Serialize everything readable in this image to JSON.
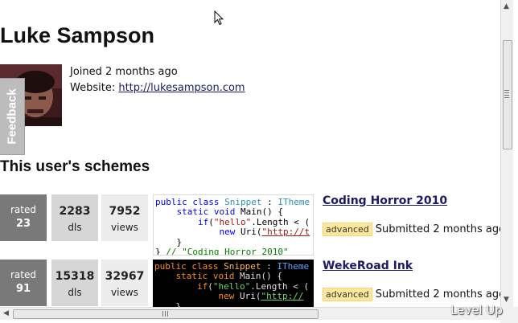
{
  "profile": {
    "name": "Luke Sampson",
    "joined": "Joined 2 months ago",
    "website_label": "Website:",
    "website_url": "http://lukesampson.com"
  },
  "feedback_tab": "Feedback",
  "section_title": "This user's schemes",
  "schemes": [
    {
      "rated_label": "rated",
      "rated_value": "23",
      "dls_value": "2283",
      "dls_label": "dls",
      "views_value": "7952",
      "views_label": "views",
      "title": "Coding Horror 2010",
      "badge": "advanced",
      "submitted": "Submitted 2 months ago",
      "theme": "light",
      "code_lines": [
        "public class Snippet : ITheme",
        "    static void Main() {",
        "        if(\"hello\".Length < (",
        "            new Uri(\"http://t",
        "    }",
        "} // \"Coding Horror 2010\""
      ]
    },
    {
      "rated_label": "rated",
      "rated_value": "91",
      "dls_value": "15318",
      "dls_label": "dls",
      "views_value": "32967",
      "views_label": "views",
      "title": "WekeRoad Ink",
      "badge": "advanced",
      "submitted": "Submitted 2 months ago",
      "theme": "dark",
      "code_lines": [
        "public class Snippet : ITheme",
        "    static void Main() {",
        "        if(\"hello\".Length < (",
        "            new Uri(\"http://t",
        "    }"
      ]
    }
  ],
  "watermark": "Level Up",
  "icons": {
    "cursor": "mouse-pointer-icon",
    "scroll_up": "scroll-up-arrow-icon",
    "scroll_down": "scroll-down-arrow-icon",
    "scroll_left": "scroll-left-arrow-icon"
  },
  "colors": {
    "link": "#1a1a66",
    "rated_bg": "#797979",
    "dls_bg": "#d6d6d6",
    "views_bg": "#ececec",
    "badge_bg": "#fde79a",
    "feedback_bg": "#bcbcbc"
  }
}
